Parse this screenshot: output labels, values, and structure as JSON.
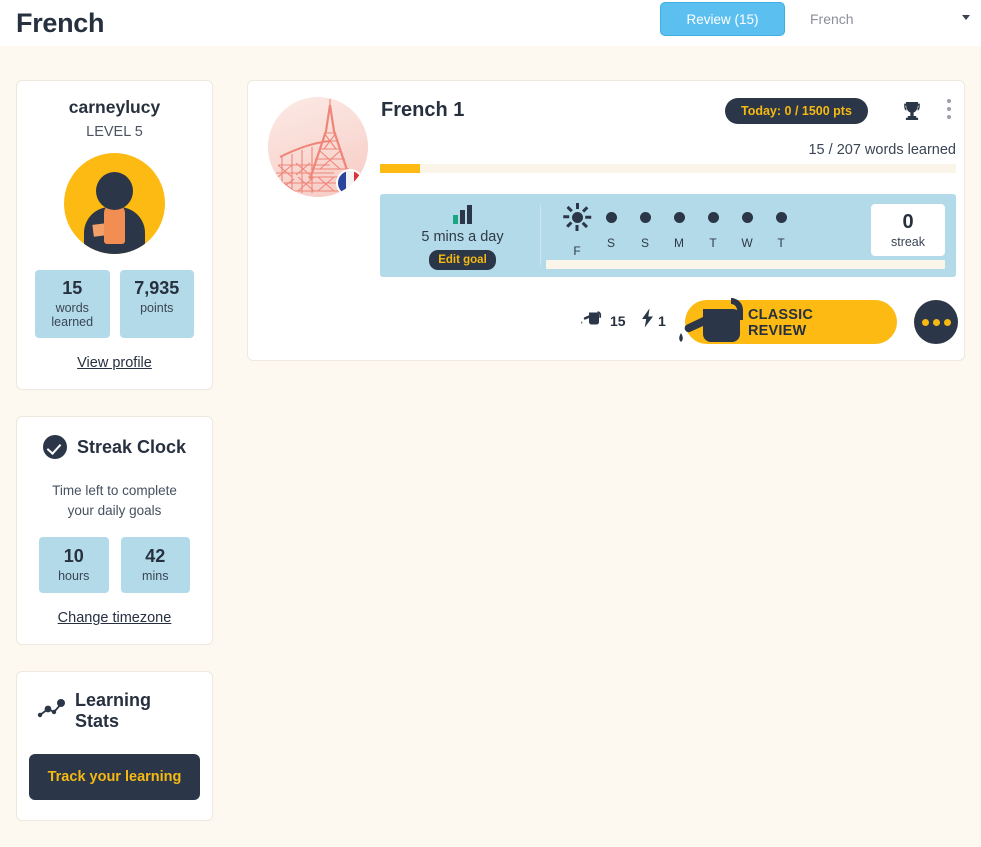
{
  "topbar": {
    "title": "French",
    "review_button": "Review (15)",
    "language_selected": "French"
  },
  "sidebar": {
    "profile": {
      "username": "carneylucy",
      "level": "LEVEL 5",
      "stats": [
        {
          "value": "15",
          "label": "words learned"
        },
        {
          "value": "7,935",
          "label": "points"
        }
      ],
      "view_profile": "View profile"
    },
    "streak_clock": {
      "title": "Streak Clock",
      "subtitle": "Time left to complete your daily goals",
      "units": [
        {
          "value": "10",
          "label": "hours"
        },
        {
          "value": "42",
          "label": "mins"
        }
      ],
      "change_timezone": "Change timezone"
    },
    "learning_stats": {
      "title": "Learning Stats",
      "track_button": "Track your learning"
    }
  },
  "course": {
    "title": "French 1",
    "today_badge": "Today: 0 / 1500 pts",
    "words_learned": "15 / 207 words learned",
    "progress_percent": 7,
    "goal": {
      "text": "5 mins a day",
      "edit_label": "Edit goal"
    },
    "week": [
      {
        "label": "F",
        "today": true
      },
      {
        "label": "S",
        "today": false
      },
      {
        "label": "S",
        "today": false
      },
      {
        "label": "M",
        "today": false
      },
      {
        "label": "T",
        "today": false
      },
      {
        "label": "W",
        "today": false
      },
      {
        "label": "T",
        "today": false
      }
    ],
    "streak": {
      "value": "0",
      "label": "streak"
    },
    "inner_progress_percent": 0,
    "actions": {
      "water_count": "15",
      "bolt_count": "1",
      "classic_review_line1": "CLASSIC",
      "classic_review_line2": "REVIEW"
    }
  },
  "colors": {
    "page_bg": "#FDF9F0",
    "accent_yellow": "#FCBA12",
    "navy": "#2B3648",
    "light_blue": "#B3DAE8",
    "review_blue": "#5BC0F0",
    "green": "#1CA582"
  }
}
